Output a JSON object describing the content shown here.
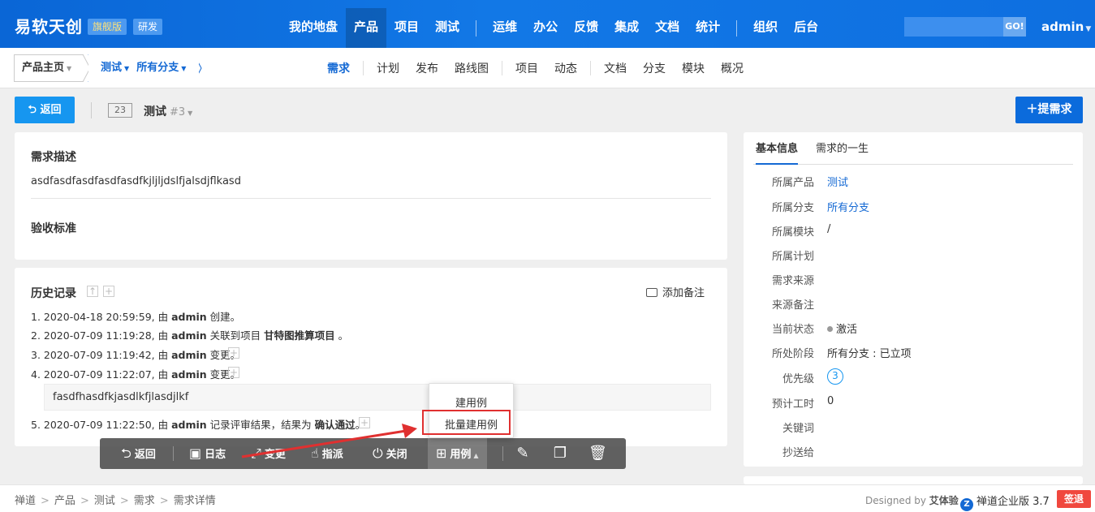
{
  "header": {
    "brand": "易软天创",
    "edition": "旗舰版",
    "dev": "研发",
    "nav": [
      "我的地盘",
      "产品",
      "项目",
      "测试",
      "运维",
      "办公",
      "反馈",
      "集成",
      "文档",
      "统计",
      "组织",
      "后台"
    ],
    "go": "GO!",
    "user": "admin"
  },
  "subnav": {
    "crumb_home": "产品主页",
    "crumb_product": "测试",
    "crumb_branch": "所有分支",
    "items": [
      "需求",
      "计划",
      "发布",
      "路线图",
      "项目",
      "动态",
      "文档",
      "分支",
      "模块",
      "概况"
    ]
  },
  "actions": {
    "back": "返回",
    "id": "23",
    "title": "测试",
    "version": "#3",
    "add_story": "提需求"
  },
  "description": {
    "title": "需求描述",
    "text": "asdfasdfasdfasdfasdfkjljljdslfjalsdjflkasd",
    "accept_title": "验收标准"
  },
  "history": {
    "title": "历史记录",
    "add_note": "添加备注",
    "entries": [
      {
        "pre": "1. 2020-04-18 20:59:59, 由 ",
        "user": "admin",
        "post": " 创建。",
        "b2": "",
        "end": ""
      },
      {
        "pre": "2. 2020-07-09 11:19:28, 由 ",
        "user": "admin",
        "post": " 关联到项目 ",
        "b2": "甘特图推算项目",
        "end": " 。"
      },
      {
        "pre": "3. 2020-07-09 11:19:42, 由 ",
        "user": "admin",
        "post": " 变更。",
        "b2": "",
        "end": ""
      },
      {
        "pre": "4. 2020-07-09 11:22:07, 由 ",
        "user": "admin",
        "post": " 变更。",
        "b2": "",
        "end": ""
      },
      {
        "pre": "5. 2020-07-09 11:22:50, 由 ",
        "user": "admin",
        "post": " 记录评审结果，结果为 ",
        "b2": "确认通过",
        "end": "。"
      }
    ],
    "quote": "fasdfhasdfkjasdlkfjlasdjlkf"
  },
  "info": {
    "tab_basic": "基本信息",
    "tab_life": "需求的一生",
    "rows": [
      {
        "label": "所属产品",
        "value": "测试"
      },
      {
        "label": "所属分支",
        "value": "所有分支"
      },
      {
        "label": "所属模块",
        "value": "/"
      },
      {
        "label": "所属计划",
        "value": ""
      },
      {
        "label": "需求来源",
        "value": ""
      },
      {
        "label": "来源备注",
        "value": ""
      },
      {
        "label": "当前状态",
        "value": "激活"
      },
      {
        "label": "所处阶段",
        "value": "所有分支 : 已立项"
      },
      {
        "label": "优先级",
        "value": "3"
      },
      {
        "label": "预计工时",
        "value": "0"
      },
      {
        "label": "关键词",
        "value": ""
      },
      {
        "label": "抄送给",
        "value": ""
      }
    ]
  },
  "toolbar": {
    "back": "返回",
    "log": "日志",
    "change": "变更",
    "assign": "指派",
    "close": "关闭",
    "case": "用例"
  },
  "dropdown": {
    "create_case": "建用例",
    "batch_create_case": "批量建用例"
  },
  "footer": {
    "crumbs": [
      "禅道",
      "产品",
      "测试",
      "需求",
      "需求详情"
    ],
    "designed_by": "Designed by",
    "designer": "艾体验",
    "product": "禅道企业版 3.7",
    "signout": "签退"
  },
  "colors": {
    "primary": "#1469d4",
    "header": "#0a66d6",
    "danger": "#e03030"
  }
}
